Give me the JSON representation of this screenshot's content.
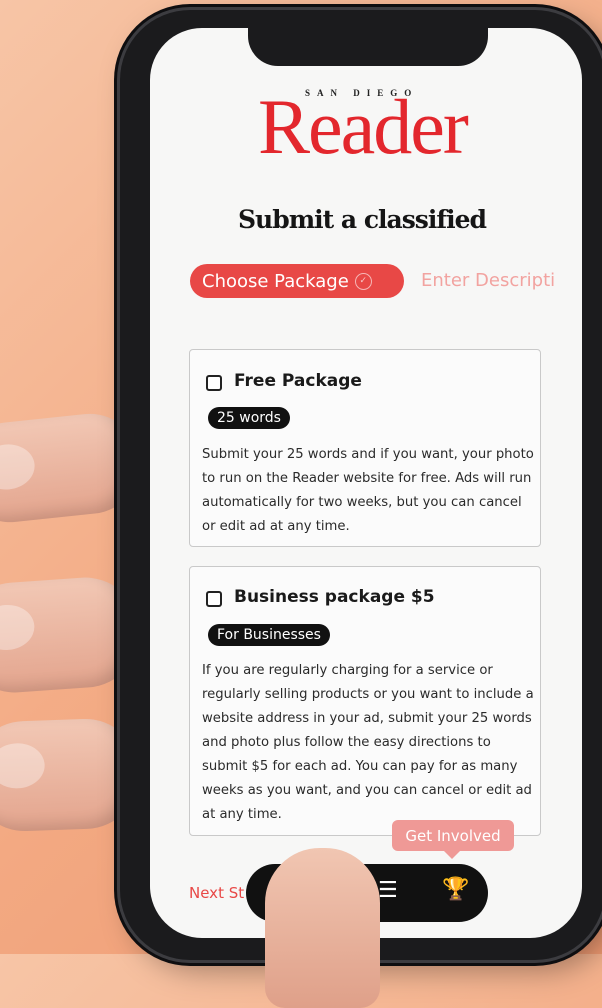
{
  "app": {
    "logo_small": "SAN DIEGO",
    "logo": "Reader"
  },
  "page": {
    "title": "Submit a classified"
  },
  "steps": {
    "active": "Choose Package",
    "next": "Enter Descripti"
  },
  "packages": [
    {
      "title": "Free Package",
      "badge": "25 words",
      "description": "Submit your 25 words and if you want, your photo to run on the Reader website for free. Ads will run automatically for two weeks, but you can cancel or edit ad at any time."
    },
    {
      "title": "Business package $5",
      "badge": "For Businesses",
      "description": "If you are regularly charging for a service or regularly selling products or you want to include a website address in your ad, submit your 25 words and photo plus follow the easy directions to submit $5 for each ad. You can pay for as many weeks as you want, and you can cancel or edit ad at any time."
    }
  ],
  "footer": {
    "next_step": "Next St",
    "tooltip": "Get Involved"
  },
  "nav_icons": [
    "search-icon",
    "menu-icon",
    "trophy-icon"
  ],
  "colors": {
    "brand_red": "#e3272d",
    "accent": "#e84846",
    "background": "#f3a982"
  }
}
